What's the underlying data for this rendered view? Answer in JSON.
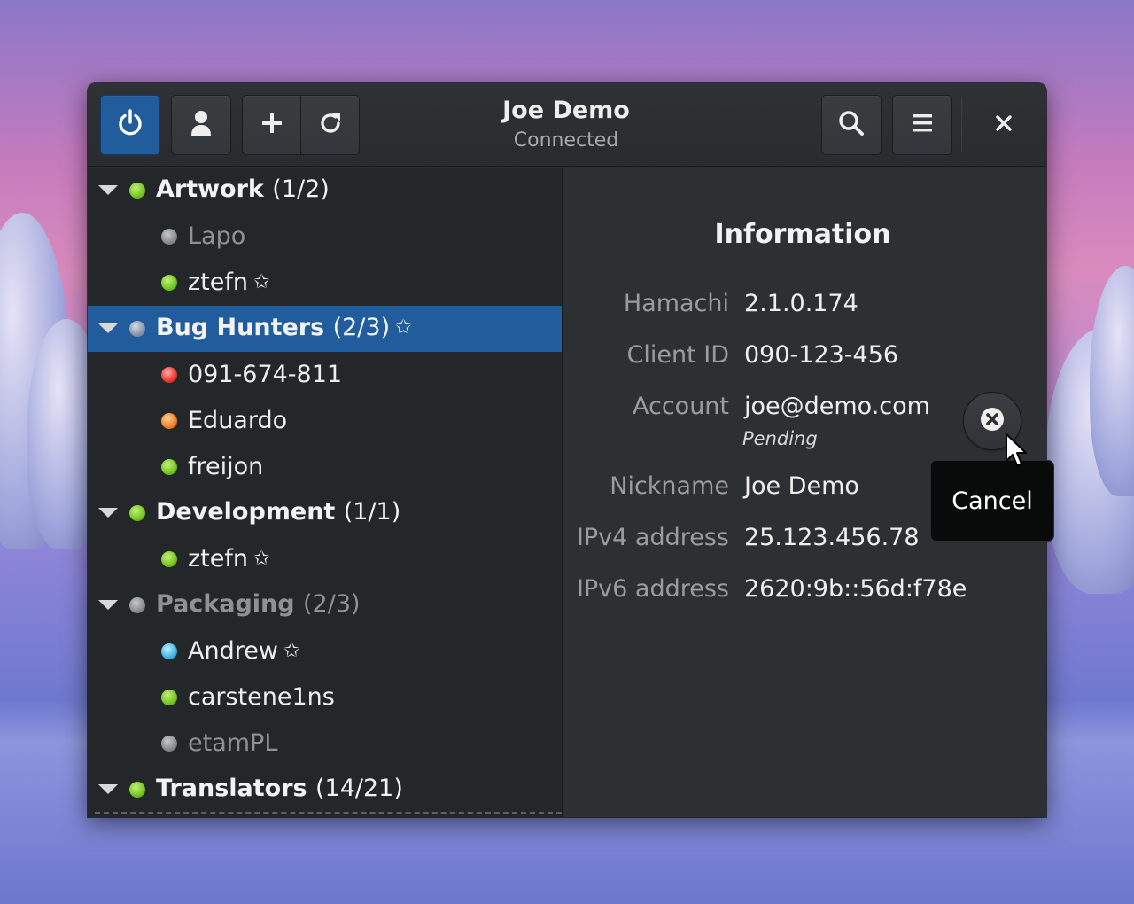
{
  "header": {
    "title": "Joe Demo",
    "subtitle": "Connected",
    "buttons": {
      "power": "power-icon",
      "user": "user-icon",
      "add": "plus-icon",
      "refresh": "refresh-icon",
      "search": "search-icon",
      "menu": "hamburger-icon",
      "close": "close-icon"
    }
  },
  "sidebar": {
    "groups": [
      {
        "name": "Artwork",
        "count": "(1/2)",
        "status": "green",
        "starred": false,
        "members": [
          {
            "name": "Lapo",
            "status": "grey",
            "starred": false
          },
          {
            "name": "ztefn",
            "status": "green",
            "starred": true
          }
        ]
      },
      {
        "name": "Bug Hunters",
        "count": "(2/3)",
        "status": "bluegrey",
        "starred": true,
        "selected": true,
        "members": [
          {
            "name": "091-674-811",
            "status": "red",
            "starred": false
          },
          {
            "name": "Eduardo",
            "status": "orange",
            "starred": false
          },
          {
            "name": "freijon",
            "status": "green",
            "starred": false
          }
        ]
      },
      {
        "name": "Development",
        "count": "(1/1)",
        "status": "green",
        "starred": false,
        "members": [
          {
            "name": "ztefn",
            "status": "green",
            "starred": true
          }
        ]
      },
      {
        "name": "Packaging",
        "count": "(2/3)",
        "status": "grey",
        "starred": false,
        "dim": true,
        "members": [
          {
            "name": "Andrew",
            "status": "blue",
            "starred": true
          },
          {
            "name": "carstene1ns",
            "status": "green",
            "starred": false
          },
          {
            "name": "etamPL",
            "status": "grey",
            "starred": false
          }
        ]
      },
      {
        "name": "Translators",
        "count": "(14/21)",
        "status": "green",
        "starred": false,
        "members": []
      }
    ],
    "star_glyph": "✩"
  },
  "info": {
    "heading": "Information",
    "rows": [
      {
        "label": "Hamachi",
        "value": "2.1.0.174"
      },
      {
        "label": "Client ID",
        "value": "090-123-456"
      },
      {
        "label": "Account",
        "value": "joe@demo.com",
        "sub": "Pending"
      },
      {
        "label": "Nickname",
        "value": "Joe Demo"
      },
      {
        "label": "IPv4 address",
        "value": "25.123.456.78"
      },
      {
        "label": "IPv6 address",
        "value": "2620:9b::56d:f78e"
      }
    ],
    "cancel_tooltip": "Cancel"
  },
  "colors": {
    "accent": "#215d9c",
    "status_online": "#7bc926",
    "status_offline": "#8f8f8f",
    "status_error": "#ef3e35",
    "status_warning": "#f4842f",
    "status_relay": "#46b7e5"
  }
}
